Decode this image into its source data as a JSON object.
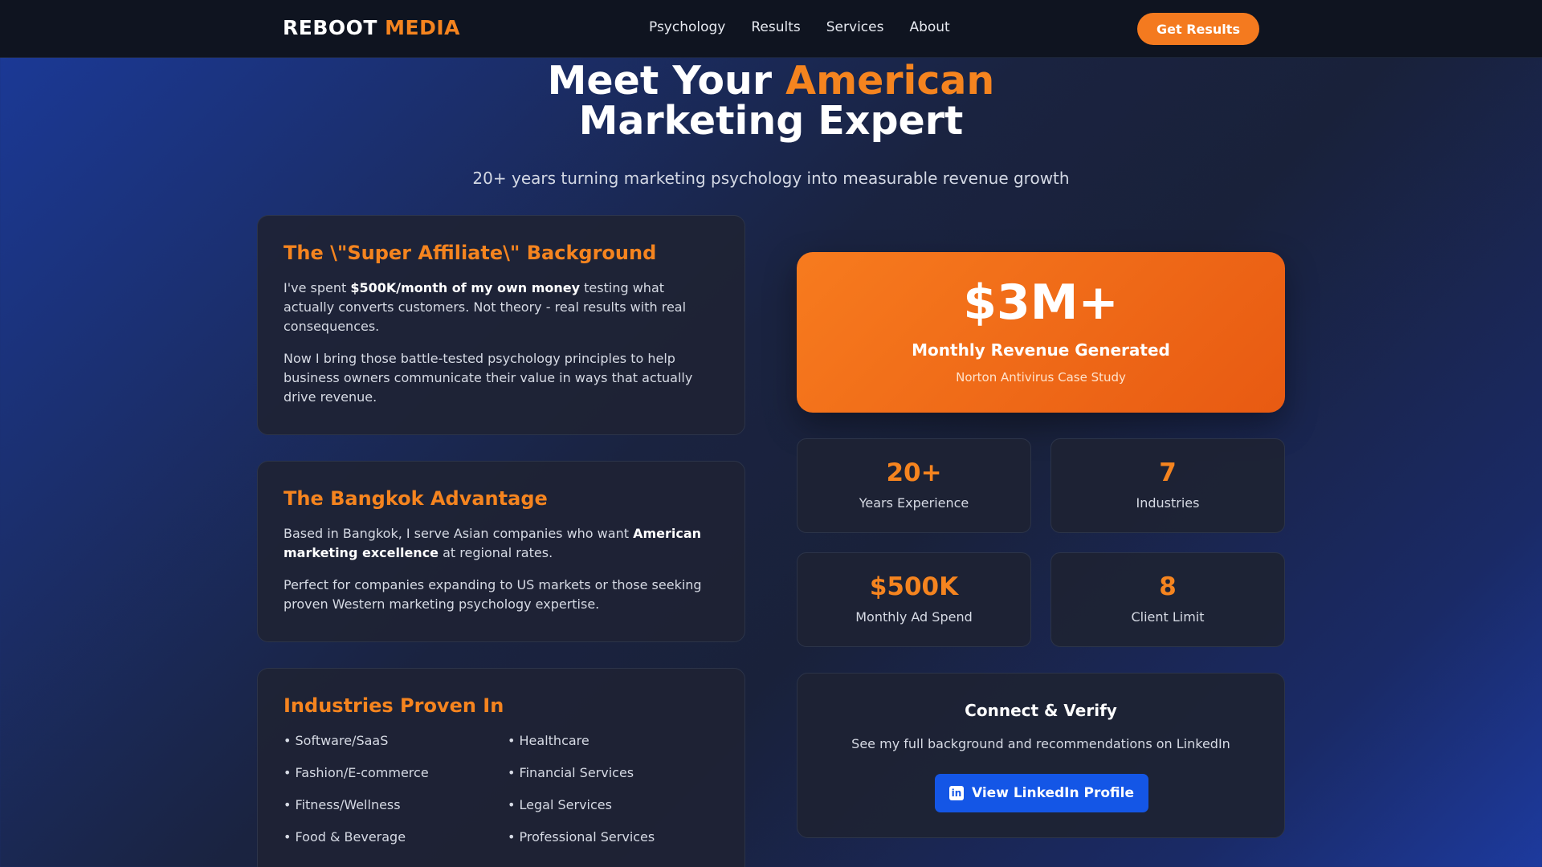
{
  "nav": {
    "logo_main": "REBOOT",
    "logo_accent": "MEDIA",
    "links": [
      "Psychology",
      "Results",
      "Services",
      "About"
    ],
    "cta": "Get Results"
  },
  "hero": {
    "title_part1": "Meet Your",
    "title_accent": "American",
    "title_line2": "Marketing Expert",
    "subtitle": "20+ years turning marketing psychology into measurable revenue growth"
  },
  "background_card": {
    "title": "The \\\"Super Affiliate\\\" Background",
    "p1_pre": "I've spent",
    "p1_bold": "$500K/month of my own money",
    "p1_post": "testing what actually converts customers. Not theory - real results with real consequences.",
    "p2": "Now I bring those battle-tested psychology principles to help business owners communicate their value in ways that actually drive revenue."
  },
  "bangkok_card": {
    "title": "The Bangkok Advantage",
    "p1_pre": "Based in Bangkok, I serve Asian companies who want",
    "p1_bold": "American marketing excellence",
    "p1_post": "at regional rates.",
    "p2": "Perfect for companies expanding to US markets or those seeking proven Western marketing psychology expertise."
  },
  "industries_card": {
    "title": "Industries Proven In",
    "items": [
      "• Software/SaaS",
      "• Healthcare",
      "• Fashion/E-commerce",
      "• Financial Services",
      "• Fitness/Wellness",
      "• Legal Services",
      "• Food & Beverage",
      "• Professional Services"
    ]
  },
  "headline_stat": {
    "value": "$3M+",
    "label": "Monthly Revenue Generated",
    "note": "Norton Antivirus Case Study"
  },
  "stats": [
    {
      "value": "20+",
      "label": "Years Experience"
    },
    {
      "value": "7",
      "label": "Industries"
    },
    {
      "value": "$500K",
      "label": "Monthly Ad Spend"
    },
    {
      "value": "8",
      "label": "Client Limit"
    }
  ],
  "connect": {
    "title": "Connect & Verify",
    "text": "See my full background and recommendations on LinkedIn",
    "button": "View LinkedIn Profile",
    "button_icon": "linkedin-icon"
  },
  "colors": {
    "accent": "#f5841f",
    "nav_bg": "#0f1420",
    "card_bg": "#1e2334",
    "linkedin_blue": "#1456e6"
  }
}
